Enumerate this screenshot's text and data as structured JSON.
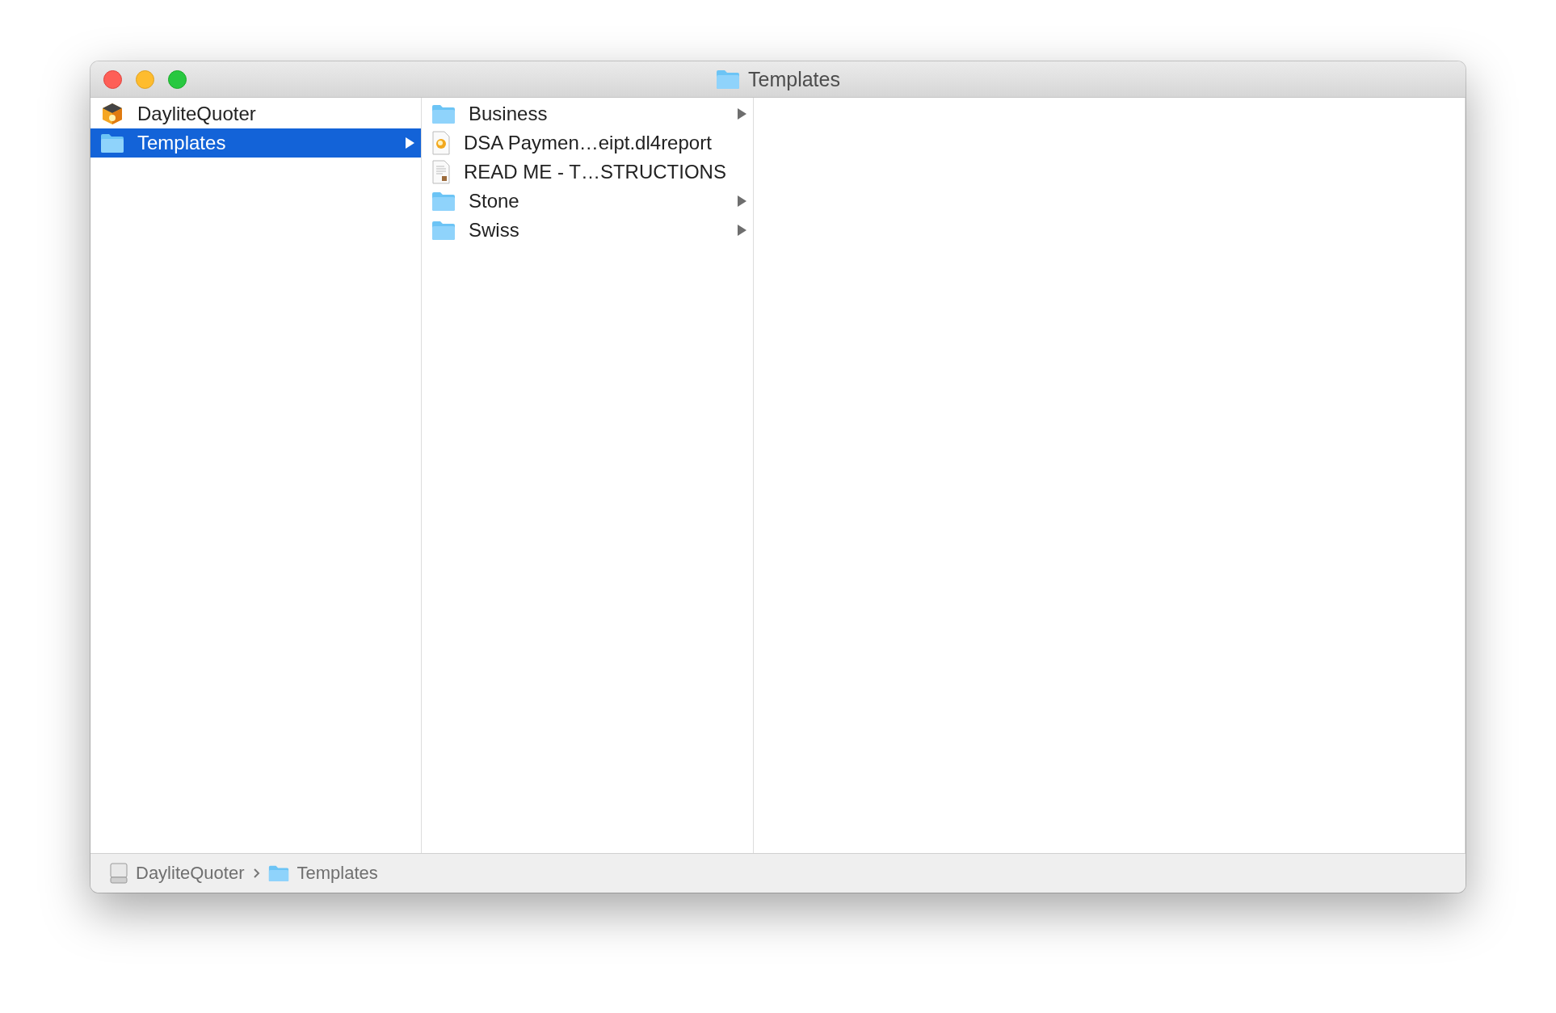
{
  "window": {
    "title": "Templates"
  },
  "columns": [
    {
      "items": [
        {
          "kind": "app",
          "label": "DayliteQuoter",
          "selected": false,
          "expandable": false
        },
        {
          "kind": "folder",
          "label": "Templates",
          "selected": true,
          "expandable": true
        }
      ]
    },
    {
      "items": [
        {
          "kind": "folder",
          "label": "Business",
          "selected": false,
          "expandable": true
        },
        {
          "kind": "report",
          "label": "DSA Paymen…eipt.dl4report",
          "selected": false,
          "expandable": false
        },
        {
          "kind": "document",
          "label": "READ ME - T…STRUCTIONS",
          "selected": false,
          "expandable": false
        },
        {
          "kind": "folder",
          "label": "Stone",
          "selected": false,
          "expandable": true
        },
        {
          "kind": "folder",
          "label": "Swiss",
          "selected": false,
          "expandable": true
        }
      ]
    }
  ],
  "path_bar": [
    {
      "kind": "disk",
      "label": "DayliteQuoter"
    },
    {
      "kind": "folder",
      "label": "Templates"
    }
  ]
}
